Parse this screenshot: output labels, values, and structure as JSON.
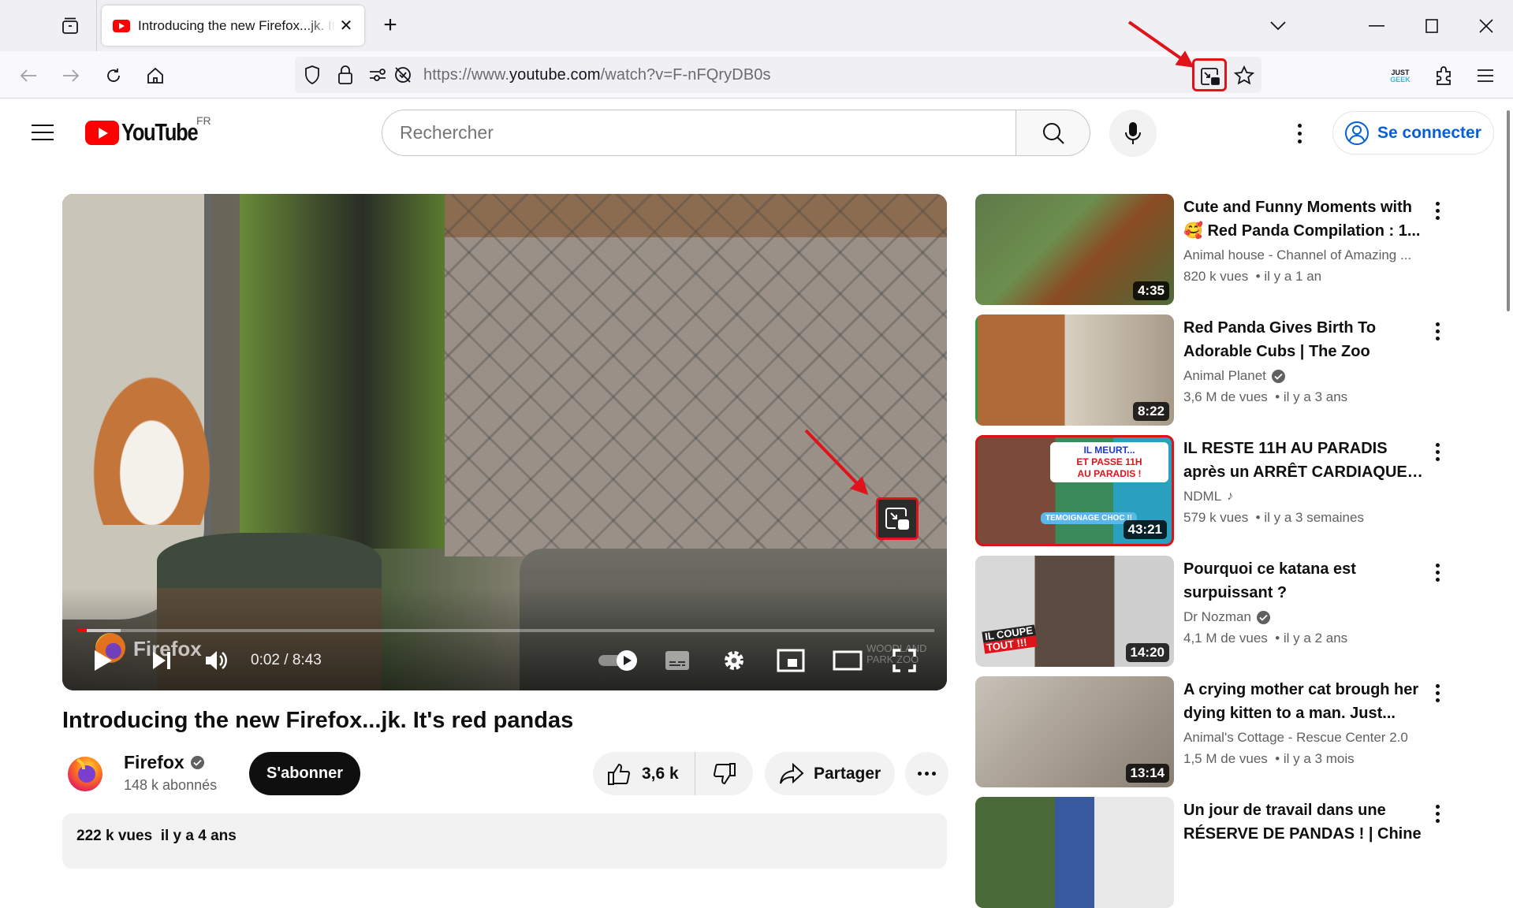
{
  "browser": {
    "tab": {
      "title": "Introducing the new Firefox...jk. It's red pandas",
      "favicon": "youtube-icon"
    },
    "new_tab_label": "+",
    "url": {
      "prefix": "https://www.",
      "host": "youtube.com",
      "path": "/watch?v=F-nFQryDB0s"
    },
    "toolbar_icons": [
      "back-icon",
      "forward-icon",
      "reload-icon",
      "home-icon",
      "shield-icon",
      "lock-icon",
      "permissions-icon",
      "tracking-icon",
      "picture-in-picture-icon",
      "bookmark-star-icon",
      "justgeek-extension-icon",
      "extensions-icon",
      "menu-icon"
    ],
    "extension_label": {
      "top": "JUST",
      "bottom": "GEEK"
    },
    "annotation_color": "#e0121a"
  },
  "youtube": {
    "logo_text": "YouTube",
    "region": "FR",
    "search_placeholder": "Rechercher",
    "signin_label": "Se connecter",
    "brand_color": "#ff0000",
    "link_color": "#065fd4"
  },
  "player": {
    "current_time": "0:02",
    "duration": "8:43",
    "time_display": "0:02 / 8:43",
    "progress_fraction": 0.004,
    "buffered_fraction": 0.05,
    "watermark": "Firefox",
    "corner_watermark": "WOODLAND PARK ZOO"
  },
  "video": {
    "title": "Introducing the new Firefox...jk. It's red pandas",
    "channel": "Firefox",
    "subscribers": "148 k abonnés",
    "subscribe_label": "S'abonner",
    "likes": "3,6 k",
    "share_label": "Partager",
    "views": "222 k vues",
    "age": "il y a 4 ans"
  },
  "recommendations": [
    {
      "title": "Cute and Funny Moments with 🥰 Red Panda Compilation : 1...",
      "channel": "Animal house - Channel of Amazing ...",
      "verified": false,
      "music": false,
      "views": "820 k vues",
      "age": "il y a 1 an",
      "duration": "4:35"
    },
    {
      "title": "Red Panda Gives Birth To Adorable Cubs | The Zoo",
      "channel": "Animal Planet",
      "verified": true,
      "music": false,
      "views": "3,6 M de vues",
      "age": "il y a 3 ans",
      "duration": "8:22"
    },
    {
      "title": "IL RESTE 11H AU PARADIS après un ARRÊT CARDIAQUE !...",
      "channel": "NDML",
      "verified": false,
      "music": true,
      "views": "579 k vues",
      "age": "il y a 3 semaines",
      "duration": "43:21",
      "thumb_text": [
        "IL MEURT...",
        "ET PASSE 11H",
        "AU PARADIS !",
        "TEMOIGNAGE CHOC !!"
      ]
    },
    {
      "title": "Pourquoi ce katana est surpuissant ?",
      "channel": "Dr Nozman",
      "verified": true,
      "music": false,
      "views": "4,1 M de vues",
      "age": "il y a 2 ans",
      "duration": "14:20",
      "thumb_text": [
        "IL COUPE",
        "TOUT !!!"
      ]
    },
    {
      "title": "A crying mother cat brough her dying kitten to a man. Just...",
      "channel": "Animal's Cottage - Rescue Center 2.0",
      "verified": false,
      "music": false,
      "views": "1,5 M de vues",
      "age": "il y a 3 mois",
      "duration": "13:14"
    },
    {
      "title": "Un jour de travail dans une RÉSERVE DE PANDAS ! | Chine",
      "channel": "",
      "verified": false,
      "music": false,
      "views": "",
      "age": "",
      "duration": ""
    }
  ]
}
